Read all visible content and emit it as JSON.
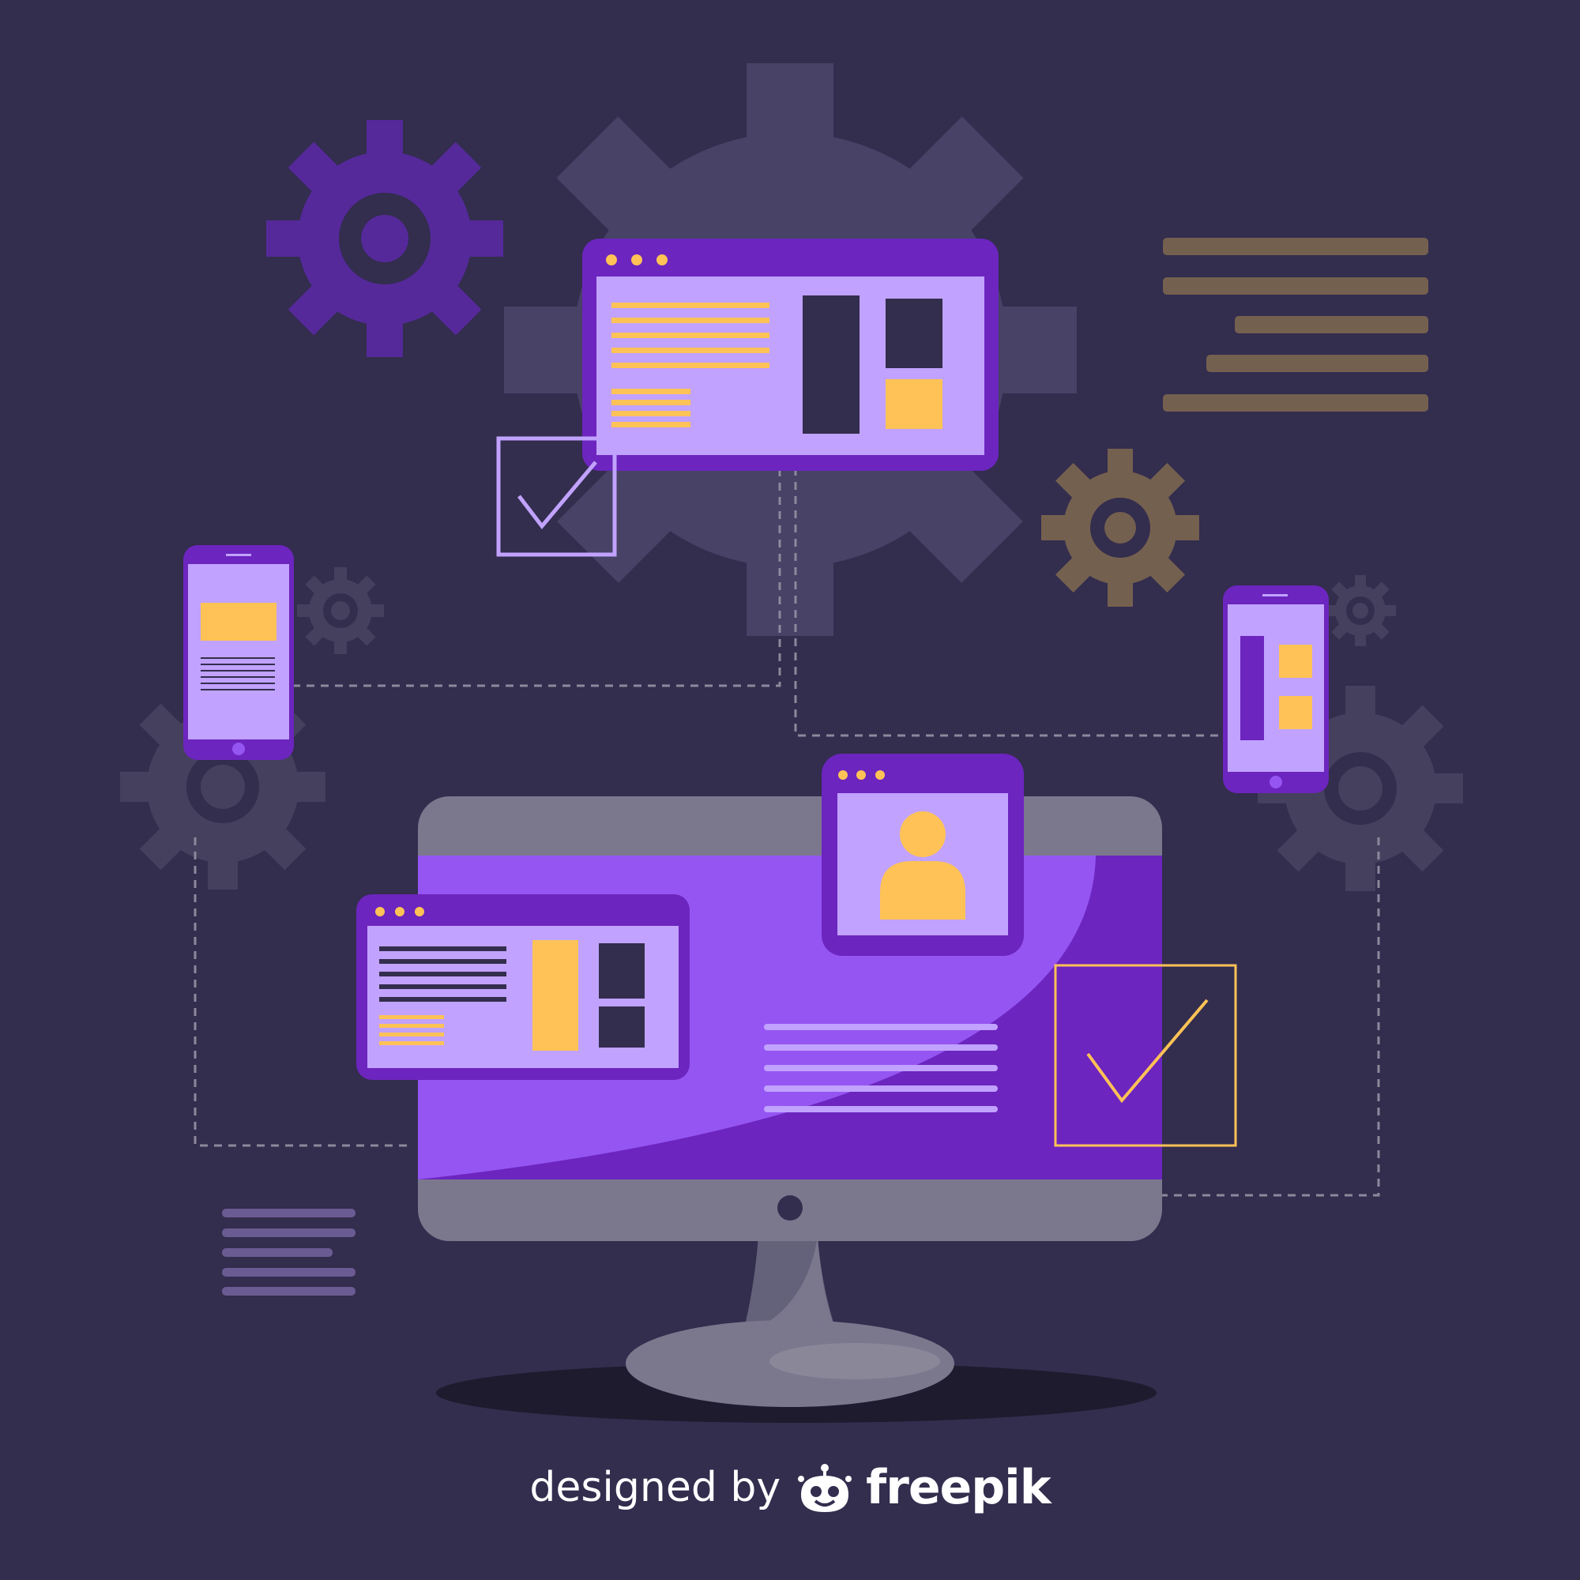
{
  "credit": {
    "lead": "designed by",
    "brand": "freepik"
  },
  "colors": {
    "background": "#332d4e",
    "big_gear": "#474266",
    "purple_gear": "#55299a",
    "brown_gear": "#74604f",
    "dark_gear": "#45405e",
    "window_frame": "#6c25be",
    "window_content": "#c1a2ff",
    "accent_yellow": "#ffc256",
    "monitor_bezel": "#7b788e",
    "screen_light": "#9555f3",
    "screen_dark": "#6c25be",
    "dashed_line": "#8d889c"
  },
  "icons": [
    "gear-icon",
    "checkmark-icon",
    "user-avatar-icon",
    "freepik-logo-icon"
  ]
}
